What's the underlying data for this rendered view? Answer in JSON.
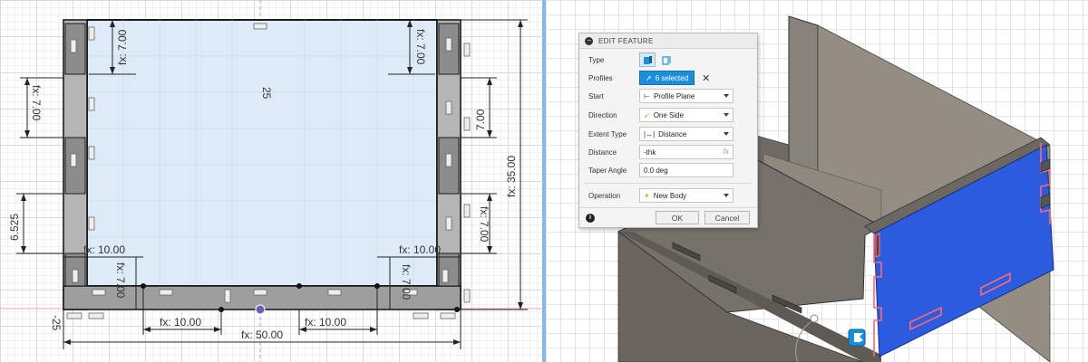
{
  "sketch": {
    "dimensions": {
      "top_left_tab": "fx: 7.00",
      "top_right_tab": "fx: 7.00",
      "left_upper": "fx: 7.00",
      "left_lower": "6.525",
      "right_upper": "7.00",
      "right_lower": "fx: 7.00",
      "height_total": "fx: 35.00",
      "bottom_left": "fx: 10.00",
      "bottom_right": "fx: 10.00",
      "width_total": "fx: 50.00",
      "inner_left": "fx: 10.00",
      "inner_right": "fx: 10.00",
      "corner_left": "fx: 7.00",
      "corner_right": "fx: 7.00",
      "center_v": "25",
      "origin": "-25"
    }
  },
  "dialog": {
    "title": "EDIT FEATURE",
    "collapse_glyph": "−",
    "rows": {
      "type": {
        "label": "Type"
      },
      "profiles": {
        "label": "Profiles",
        "value": "6 selected"
      },
      "start": {
        "label": "Start",
        "value": "Profile Plane"
      },
      "direction": {
        "label": "Direction",
        "value": "One Side"
      },
      "extent_type": {
        "label": "Extent Type",
        "value": "Distance"
      },
      "distance": {
        "label": "Distance",
        "value": "-thk",
        "fx": "fx"
      },
      "taper_angle": {
        "label": "Taper Angle",
        "value": "0.0 deg"
      },
      "operation": {
        "label": "Operation",
        "value": "New Body"
      }
    },
    "clear_glyph": "✕",
    "ok_label": "OK",
    "cancel_label": "Cancel",
    "info_glyph": "i"
  },
  "colors": {
    "sketch_profile_fill": "#dcebf7",
    "slot_fill": "#9a9a9a",
    "model_body": "#7d776f",
    "model_face": "#2b5ce0",
    "highlight": "#ff6a73",
    "accent": "#1c8fdb"
  }
}
